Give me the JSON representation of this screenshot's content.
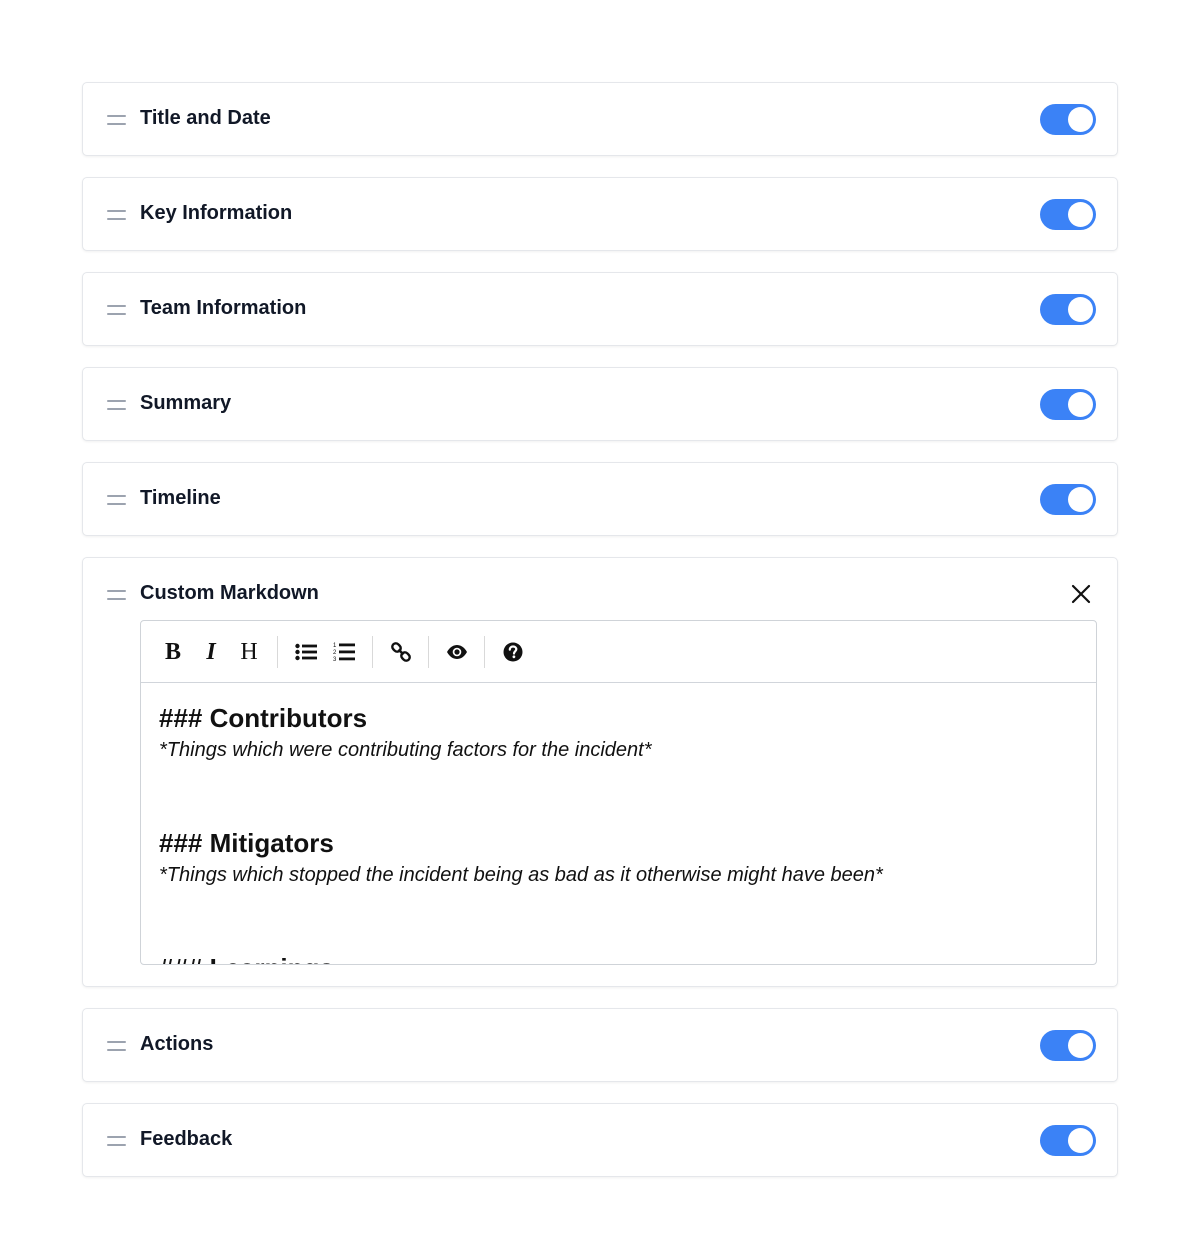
{
  "sections": [
    {
      "label": "Title and Date",
      "enabled": true
    },
    {
      "label": "Key Information",
      "enabled": true
    },
    {
      "label": "Team Information",
      "enabled": true
    },
    {
      "label": "Summary",
      "enabled": true
    },
    {
      "label": "Timeline",
      "enabled": true
    }
  ],
  "custom": {
    "label": "Custom Markdown",
    "toolbar": {
      "bold": "B",
      "italic": "I",
      "heading": "H"
    },
    "content": {
      "h1": "### Contributors",
      "p1": "*Things which were contributing factors for the incident*",
      "h2": "### Mitigators",
      "p2": "*Things which stopped the incident being as bad as it otherwise might have been*",
      "h3": "### Learnings"
    }
  },
  "bottom_sections": [
    {
      "label": "Actions",
      "enabled": true
    },
    {
      "label": "Feedback",
      "enabled": true
    }
  ],
  "colors": {
    "toggle_on": "#3b82f6",
    "handle": "#9ca3af"
  },
  "icons": {
    "drag": "drag-handle-icon",
    "toggle": "toggle-switch",
    "close": "close-icon",
    "bullet_list": "bullet-list-icon",
    "numbered_list": "numbered-list-icon",
    "link": "link-icon",
    "preview": "eye-icon",
    "help": "question-circle-icon"
  }
}
